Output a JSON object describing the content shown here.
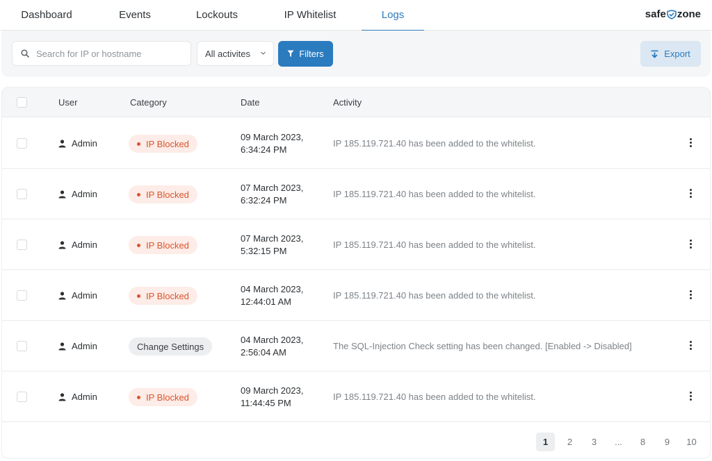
{
  "nav": {
    "tabs": [
      {
        "label": "Dashboard"
      },
      {
        "label": "Events"
      },
      {
        "label": "Lockouts"
      },
      {
        "label": "IP Whitelist"
      },
      {
        "label": "Logs",
        "active": true
      }
    ],
    "logo": {
      "left": "safe",
      "right": "zone"
    }
  },
  "toolbar": {
    "search_placeholder": "Search for IP or hostname",
    "search_value": "",
    "activity_select": "All activites",
    "filters_label": "Filters",
    "export_label": "Export"
  },
  "table": {
    "headers": {
      "user": "User",
      "category": "Category",
      "date": "Date",
      "activity": "Activity"
    },
    "rows": [
      {
        "user": "Admin",
        "category": "IP Blocked",
        "category_type": "blocked",
        "date_line1": "09 March 2023,",
        "date_line2": "6:34:24 PM",
        "activity": "IP 185.119.721.40 has been added to the whitelist."
      },
      {
        "user": "Admin",
        "category": "IP Blocked",
        "category_type": "blocked",
        "date_line1": "07 March 2023,",
        "date_line2": "6:32:24 PM",
        "activity": "IP 185.119.721.40 has been added to the whitelist."
      },
      {
        "user": "Admin",
        "category": "IP Blocked",
        "category_type": "blocked",
        "date_line1": "07 March 2023,",
        "date_line2": "5:32:15 PM",
        "activity": "IP 185.119.721.40 has been added to the whitelist."
      },
      {
        "user": "Admin",
        "category": "IP Blocked",
        "category_type": "blocked",
        "date_line1": "04 March 2023,",
        "date_line2": "12:44:01 AM",
        "activity": "IP 185.119.721.40 has been added to the whitelist."
      },
      {
        "user": "Admin",
        "category": "Change Settings",
        "category_type": "settings",
        "date_line1": "04 March 2023,",
        "date_line2": "2:56:04 AM",
        "activity": "The SQL-Injection Check setting has been changed. [Enabled -> Disabled]"
      },
      {
        "user": "Admin",
        "category": "IP Blocked",
        "category_type": "blocked",
        "date_line1": "09 March 2023,",
        "date_line2": "11:44:45 PM",
        "activity": "IP 185.119.721.40 has been added to the whitelist."
      }
    ]
  },
  "pagination": {
    "pages": [
      "1",
      "2",
      "3",
      "...",
      "8",
      "9",
      "10"
    ],
    "current": "1"
  },
  "colors": {
    "accent": "#2b7bbf",
    "blocked_text": "#d9552c",
    "blocked_bg": "#fdece7"
  },
  "icons": {
    "search": "search-icon",
    "chevron": "chevron-down-icon",
    "filter": "filter-icon",
    "export": "download-icon",
    "user": "user-icon",
    "more": "more-vertical-icon",
    "logo": "shield-icon"
  }
}
